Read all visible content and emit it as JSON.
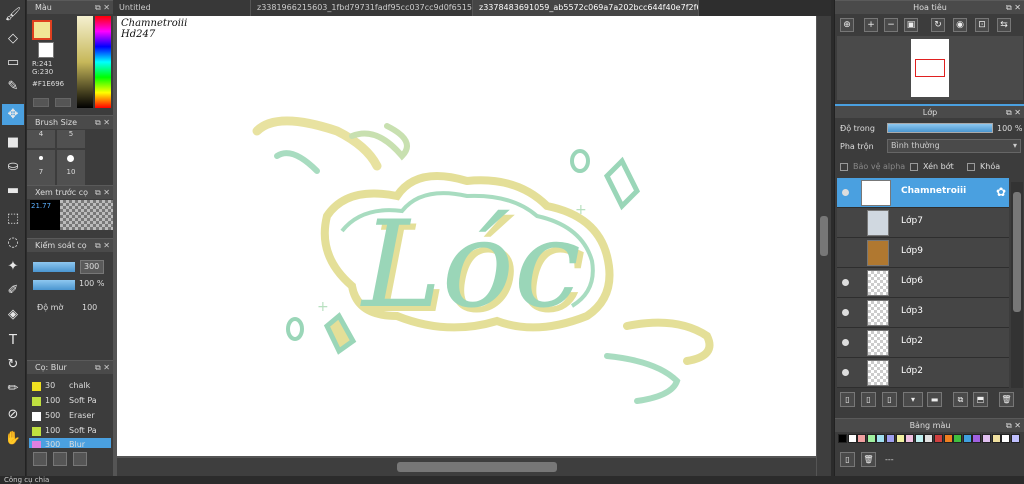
{
  "tabs": [
    {
      "label": "Untitled",
      "active": false
    },
    {
      "label": "z3381966215603_1fbd79731fadf95cc037cc9d0f651501.jpg",
      "active": false
    },
    {
      "label": "z3378483691059_ab5572c069a7a202bcc644f40e7f2f6b.jpg",
      "active": true
    }
  ],
  "color_panel": {
    "title": "Màu",
    "r": "R:241",
    "g": "G:230",
    "hex": "#F1E696",
    "fg_color": "#F1E696"
  },
  "brush_size": {
    "title": "Brush Size",
    "sizes": [
      "4",
      "5",
      "",
      "",
      "7",
      "10"
    ]
  },
  "preview_panel": {
    "title": "Xem trước cọ",
    "value": "21.77"
  },
  "brush_control": {
    "title": "Kiểm soát cọ",
    "size_value": "300",
    "opacity_value": "100 %",
    "density_label": "Độ mờ",
    "density_value": "100"
  },
  "brush_list": {
    "title": "Cọ: Blur",
    "items": [
      {
        "size": "30",
        "name": "chalk",
        "color": "#f0e020"
      },
      {
        "size": "100",
        "name": "Soft Pa",
        "color": "#c0e040"
      },
      {
        "size": "500",
        "name": "Eraser",
        "color": "#ffffff"
      },
      {
        "size": "100",
        "name": "Soft Pa",
        "color": "#c0e040"
      },
      {
        "size": "300",
        "name": "Blur",
        "color": "#e080e0"
      }
    ]
  },
  "canvas": {
    "signature_line1": "Chamnetroiii",
    "signature_line2": "Hd247",
    "artwork_text": "Lóc"
  },
  "navigator": {
    "title": "Hoa tiêu"
  },
  "layers_panel": {
    "title": "Lớp",
    "opacity_label": "Độ trong",
    "opacity_value": "100 %",
    "blend_label": "Pha trộn",
    "blend_value": "Bình thường",
    "protect_alpha": "Bảo vệ alpha",
    "clipping": "Xén bớt",
    "lock": "Khóa",
    "layers": [
      {
        "name": "Chamnetroiii",
        "active": true,
        "visible": true
      },
      {
        "name": "Lớp7",
        "active": false,
        "visible": false
      },
      {
        "name": "Lớp9",
        "active": false,
        "visible": false
      },
      {
        "name": "Lớp6",
        "active": false,
        "visible": true
      },
      {
        "name": "Lớp3",
        "active": false,
        "visible": true
      },
      {
        "name": "Lớp2",
        "active": false,
        "visible": true
      },
      {
        "name": "Lớp2",
        "active": false,
        "visible": true
      }
    ]
  },
  "palette": {
    "title": "Bảng màu",
    "dash": "---",
    "colors": [
      "#000000",
      "#ffffff",
      "#f0a0a0",
      "#a0f0a0",
      "#a0e0f0",
      "#a0a0f0",
      "#f0f0a0",
      "#f0c0e0",
      "#c0f0f0",
      "#e0e0e0",
      "#d04040",
      "#f08020",
      "#40c040",
      "#40a0e0",
      "#a060e0",
      "#e0c0f0",
      "#f0e0a0",
      "#ffffff",
      "#c0c0ff"
    ]
  },
  "status_bar": "Công cụ chia"
}
